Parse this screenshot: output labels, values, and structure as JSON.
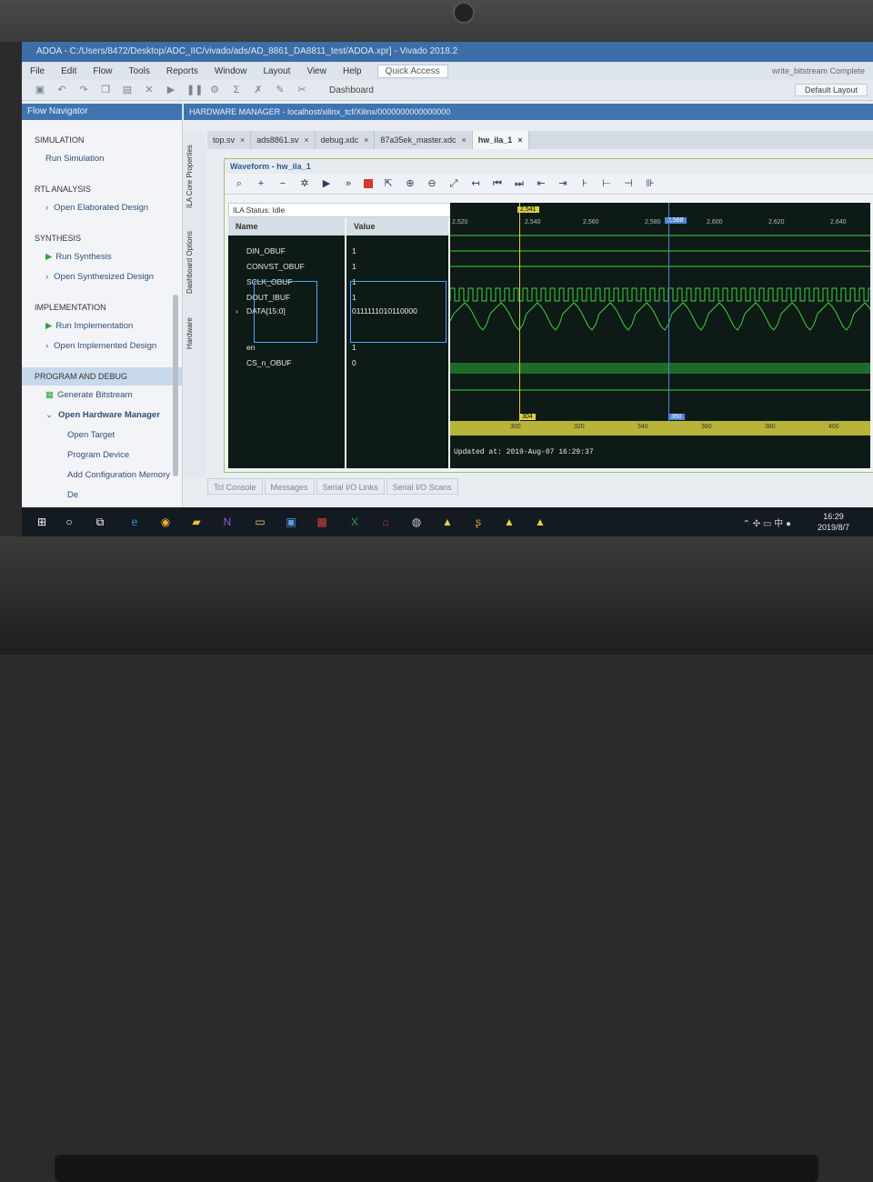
{
  "window": {
    "title": "ADOA - C:/Users/8472/Desktop/ADC_IIC/vivado/ads/AD_8861_DA8811_test/ADOA.xpr] - Vivado 2018.2"
  },
  "menu": [
    "File",
    "Edit",
    "Flow",
    "Tools",
    "Reports",
    "Window",
    "Layout",
    "View",
    "Help"
  ],
  "quick_access": "Quick Access",
  "menu_right": "write_bitstream Complete",
  "toolbar": {
    "dashboard": "Dashboard",
    "layout": "Default Layout"
  },
  "nav": {
    "title": "Flow Navigator",
    "sections": [
      {
        "label": "SIMULATION",
        "items": [
          "Run Simulation"
        ]
      },
      {
        "label": "RTL ANALYSIS",
        "items": [
          "Open Elaborated Design"
        ]
      },
      {
        "label": "SYNTHESIS",
        "items": [
          "Run Synthesis",
          "Open Synthesized Design"
        ]
      },
      {
        "label": "IMPLEMENTATION",
        "items": [
          "Run Implementation",
          "Open Implemented Design"
        ]
      },
      {
        "label": "PROGRAM AND DEBUG",
        "items": [
          "Generate Bitstream",
          "Open Hardware Manager",
          "Open Target",
          "Program Device",
          "Add Configuration Memory De"
        ]
      }
    ]
  },
  "hw_manager": {
    "title": "HARDWARE MANAGER - localhost/xilinx_tcf/Xilinx/0000000000000000"
  },
  "tabs": [
    "top.sv",
    "ads8861.sv",
    "debug.xdc",
    "87a35ek_master.xdc",
    "hw_ila_1"
  ],
  "side_tabs": [
    "ILA Core Properties",
    "Dashboard Options",
    "Hardware"
  ],
  "waveform": {
    "title": "Waveform - hw_ila_1",
    "ila_status": "ILA Status:  Idle",
    "col_name": "Name",
    "col_value": "Value",
    "signals": [
      {
        "name": "DIN_OBUF",
        "value": "1"
      },
      {
        "name": "CONVST_OBUF",
        "value": "1"
      },
      {
        "name": "SCLK_OBUF",
        "value": "1"
      },
      {
        "name": "DOUT_IBUF",
        "value": "1"
      },
      {
        "name": "DATA[15:0]",
        "value": "0111111010110000"
      },
      {
        "name": "en",
        "value": "1"
      },
      {
        "name": "CS_n_OBUF",
        "value": "0"
      }
    ],
    "time_ticks": [
      "2,520",
      "2,540",
      "2,560",
      "2,580",
      "2,600",
      "2,620",
      "2,640"
    ],
    "bottom_ticks": [
      "300",
      "320",
      "340",
      "360",
      "380",
      "400"
    ],
    "cursor_yellow": "2,541",
    "cursor_blue": "2,588",
    "marker_yellow": "304",
    "marker_blue": "350",
    "updated": "Updated at: 2019-Aug-07 16:29:37"
  },
  "bottom_tabs": [
    "Tcl Console",
    "Messages",
    "Serial I/O Links",
    "Serial I/O Scans"
  ],
  "taskbar": {
    "time": "16:29",
    "date": "2019/8/7",
    "ime": "中"
  }
}
